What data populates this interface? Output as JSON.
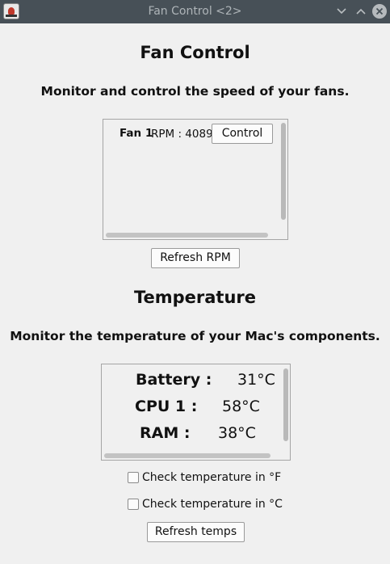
{
  "window": {
    "title": "Fan Control <2>"
  },
  "fan_section": {
    "heading": "Fan Control",
    "subheading": "Monitor and control the speed of your fans.",
    "fans": [
      {
        "name": "Fan 1",
        "rpm_text": "RPM : 4089",
        "control_label": "Control"
      }
    ],
    "refresh_label": "Refresh RPM"
  },
  "temp_section": {
    "heading": "Temperature",
    "subheading": "Monitor the temperature of your Mac's components.",
    "readings": [
      {
        "label": "Battery :",
        "value": "31°C"
      },
      {
        "label": "CPU 1 :",
        "value": "58°C"
      },
      {
        "label": "RAM :",
        "value": "38°C"
      }
    ],
    "options": [
      {
        "label": "Check temperature in °F",
        "checked": false
      },
      {
        "label": "Check temperature in °C",
        "checked": false
      }
    ],
    "refresh_label": "Refresh temps"
  },
  "colors": {
    "titlebar": "#475057",
    "background": "#f0f0f0"
  },
  "icons": [
    "app-icon",
    "minimize-icon",
    "maximize-icon",
    "close-icon"
  ]
}
